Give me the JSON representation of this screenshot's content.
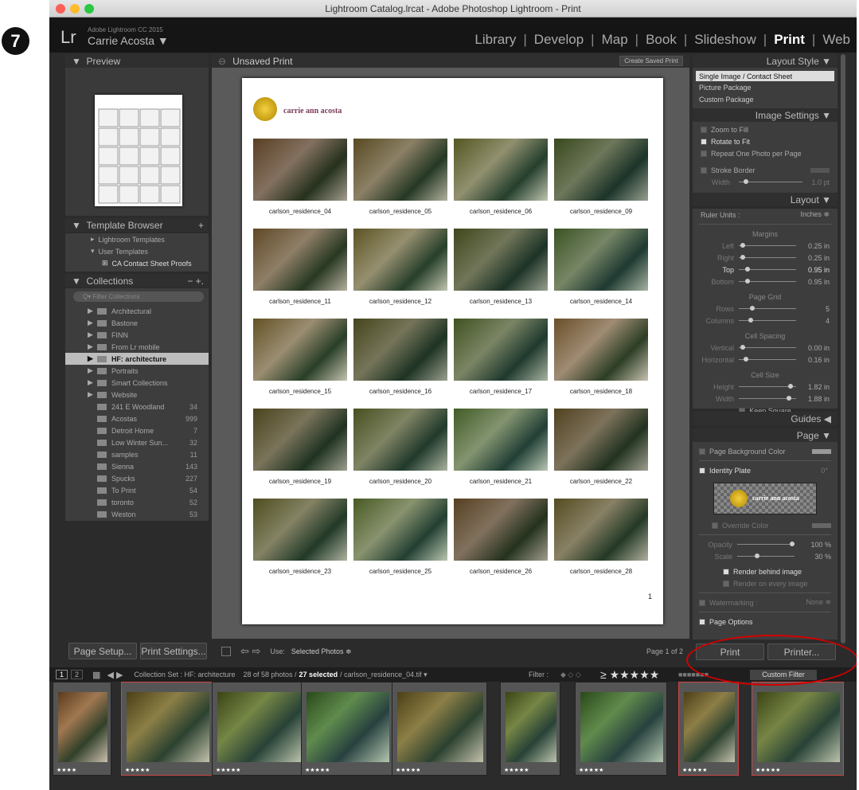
{
  "step_number": "7",
  "window": {
    "title": "Lightroom Catalog.lrcat - Adobe Photoshop Lightroom - Print"
  },
  "identity": {
    "logo": "Lr",
    "product": "Adobe Lightroom CC 2015",
    "user": "Carrie Acosta ▼"
  },
  "modules": [
    {
      "label": "Library"
    },
    {
      "label": "Develop"
    },
    {
      "label": "Map"
    },
    {
      "label": "Book"
    },
    {
      "label": "Slideshow"
    },
    {
      "label": "Print"
    },
    {
      "label": "Web"
    }
  ],
  "left": {
    "preview_title": "Preview",
    "template_title": "Template Browser",
    "templates": [
      {
        "label": "Lightroom Templates"
      },
      {
        "label": "User Templates"
      },
      {
        "label": "CA Contact Sheet Proofs"
      }
    ],
    "collections_title": "Collections",
    "filter_placeholder": "Filter Collections",
    "collections": [
      {
        "label": "Architectural",
        "count": ""
      },
      {
        "label": "Bastone",
        "count": ""
      },
      {
        "label": "FINN",
        "count": ""
      },
      {
        "label": "From Lr mobile",
        "count": ""
      },
      {
        "label": "HF: architecture",
        "count": ""
      },
      {
        "label": "Portraits",
        "count": ""
      },
      {
        "label": "Smart Collections",
        "count": ""
      },
      {
        "label": "Website",
        "count": ""
      },
      {
        "label": "241 E Woodland",
        "count": "34"
      },
      {
        "label": "Acostas",
        "count": "999"
      },
      {
        "label": "Detroit Home",
        "count": "7"
      },
      {
        "label": "Low Winter Sun...",
        "count": "32"
      },
      {
        "label": "samples",
        "count": "11"
      },
      {
        "label": "Sienna",
        "count": "143"
      },
      {
        "label": "Spucks",
        "count": "227"
      },
      {
        "label": "To Print",
        "count": "54"
      },
      {
        "label": "toronto",
        "count": "52"
      },
      {
        "label": "Weston",
        "count": "53"
      }
    ],
    "page_setup": "Page Setup...",
    "print_settings": "Print Settings..."
  },
  "center": {
    "title": "Unsaved Print",
    "create_saved": "Create Saved Print",
    "identity_plate": "carrie ann acosta",
    "page_number": "1",
    "captions": [
      "carlson_residence_04",
      "carlson_residence_05",
      "carlson_residence_06",
      "carlson_residence_09",
      "carlson_residence_11",
      "carlson_residence_12",
      "carlson_residence_13",
      "carlson_residence_14",
      "carlson_residence_15",
      "carlson_residence_16",
      "carlson_residence_17",
      "carlson_residence_18",
      "carlson_residence_19",
      "carlson_residence_20",
      "carlson_residence_21",
      "carlson_residence_22",
      "carlson_residence_23",
      "carlson_residence_25",
      "carlson_residence_26",
      "carlson_residence_28"
    ],
    "use_label": "Use:",
    "use_value": "Selected Photos ≑",
    "page_of": "Page 1 of 2"
  },
  "right": {
    "layout_style": "Layout Style",
    "styles": [
      {
        "label": "Single Image / Contact Sheet"
      },
      {
        "label": "Picture Package"
      },
      {
        "label": "Custom Package"
      }
    ],
    "image_settings": "Image Settings",
    "img_opts": [
      {
        "label": "Zoom to Fill"
      },
      {
        "label": "Rotate to Fit"
      },
      {
        "label": "Repeat One Photo per Page"
      }
    ],
    "stroke": "Stroke Border",
    "width_label": "Width",
    "width_val": "1.0 pt",
    "layout": "Layout",
    "ruler_label": "Ruler Units :",
    "ruler_val": "Inches ≑",
    "margins": "Margins",
    "m_left": "Left",
    "m_left_v": "0.25 in",
    "m_right": "Right",
    "m_right_v": "0.25 in",
    "m_top": "Top",
    "m_top_v": "0.95 in",
    "m_bottom": "Bottom",
    "m_bottom_v": "0.95 in",
    "page_grid": "Page Grid",
    "rows": "Rows",
    "rows_v": "5",
    "cols": "Columns",
    "cols_v": "4",
    "cell_spacing": "Cell Spacing",
    "vert": "Vertical",
    "vert_v": "0.00 in",
    "horiz": "Horizontal",
    "horiz_v": "0.16 in",
    "cell_size": "Cell Size",
    "height": "Height",
    "height_v": "1.82 in",
    "width2": "Width",
    "width2_v": "1.88 in",
    "keep_square": "Keep Square",
    "guides": "Guides",
    "page": "Page",
    "page_bg": "Page Background Color",
    "identity_plate": "Identity Plate",
    "angle": "0°",
    "plate_text": "carrie ann acosta",
    "override": "Override Color",
    "opacity": "Opacity",
    "opacity_v": "100 %",
    "scale": "Scale",
    "scale_v": "30 %",
    "render_behind": "Render behind image",
    "render_every": "Render on every image",
    "watermark": "Watermarking :",
    "watermark_v": "None ≑",
    "page_options": "Page Options",
    "print_btn": "Print",
    "printer_btn": "Printer..."
  },
  "filmstrip": {
    "collection": "Collection Set : HF: architecture",
    "count_a": "28 of 58 photos /",
    "count_b": "27 selected",
    "count_c": "/ carlson_residence_04.tif ▾",
    "filter": "Filter :",
    "stars": "≥ ★★★★★",
    "custom": "Custom Filter",
    "ratings": [
      "★★★★",
      "★★★★★",
      "★★★★★",
      "★★★★★",
      "★★★★★",
      "★★★★★",
      "★★★★★",
      "★★★★★",
      "★★★★★"
    ]
  }
}
